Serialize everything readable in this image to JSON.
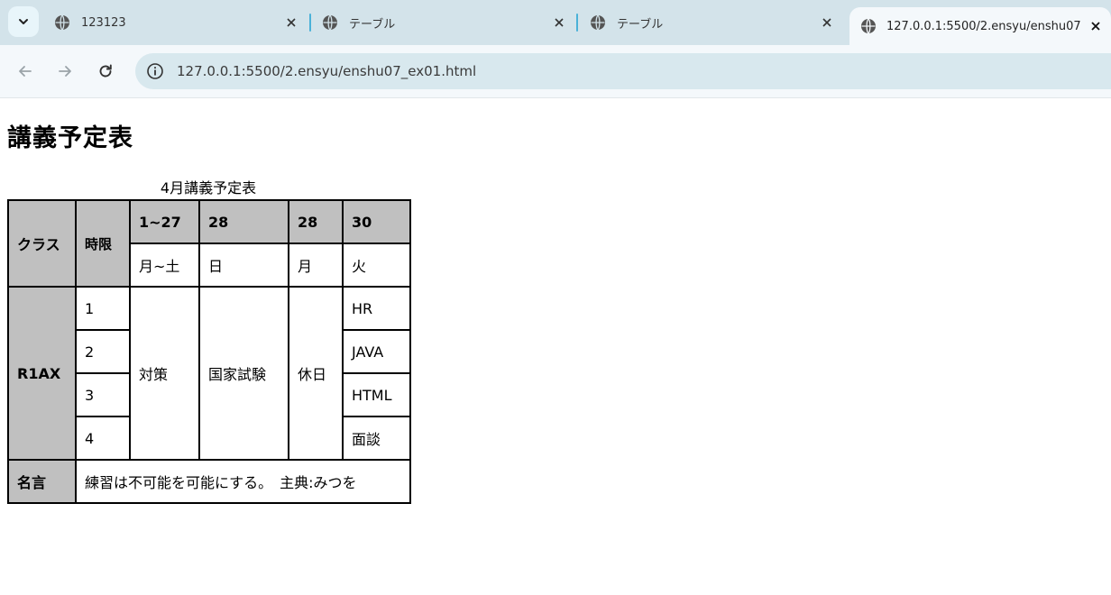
{
  "browser": {
    "tabs": [
      {
        "title": "123123",
        "active": false
      },
      {
        "title": "テーブル",
        "active": false
      },
      {
        "title": "テーブル",
        "active": false
      },
      {
        "title": "127.0.0.1:5500/2.ensyu/enshu07",
        "active": true
      }
    ],
    "url": "127.0.0.1:5500/2.ensyu/enshu07_ex01.html",
    "accent_color": "#4ab1d8"
  },
  "page": {
    "heading": "講義予定表",
    "table": {
      "caption": "4月講義予定表",
      "header": {
        "class_label": "クラス",
        "period_label": "時限",
        "dates": [
          "1~27",
          "28",
          "28",
          "30"
        ],
        "days": [
          "月~土",
          "日",
          "月",
          "火"
        ]
      },
      "class_name": "R1AX",
      "periods": [
        "1",
        "2",
        "3",
        "4"
      ],
      "span_cells": [
        "対策",
        "国家試験",
        "休日"
      ],
      "tuesday": [
        "HR",
        "JAVA",
        "HTML",
        "面談"
      ],
      "quote_label": "名言",
      "quote": "練習は不可能を可能にする。　主典:みつを"
    },
    "header_bg": "#c0c0c0"
  }
}
